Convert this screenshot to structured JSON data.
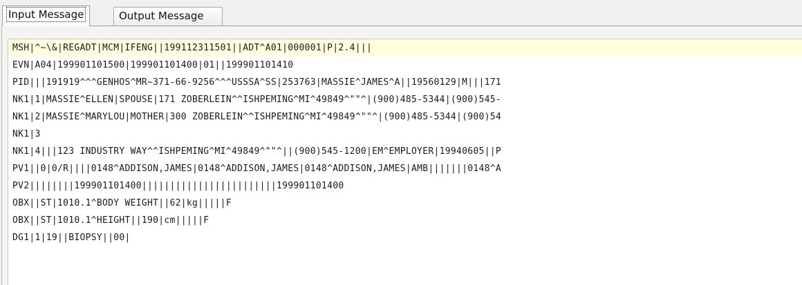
{
  "tabs": [
    {
      "label": "Input Message",
      "active": true
    },
    {
      "label": "Output Message",
      "active": false
    }
  ],
  "editor": {
    "highlight_color": "#ffffe0",
    "lines": [
      "MSH|^~\\&|REGADT|MCM|IFENG||199112311501||ADT^A01|000001|P|2.4|||",
      "EVN|A04|199901101500|199901101400|01||199901101410",
      "PID|||191919^^^GENHOS^MR~371-66-9256^^^USSSA^SS|253763|MASSIE^JAMES^A||19560129|M|||171",
      "NK1|1|MASSIE^ELLEN|SPOUSE|171 ZOBERLEIN^^ISHPEMING^MI^49849^\"\"^|(900)485-5344|(900)545-",
      "NK1|2|MASSIE^MARYLOU|MOTHER|300 ZOBERLEIN^^ISHPEMING^MI^49849^\"\"^|(900)485-5344|(900)54",
      "NK1|3",
      "NK1|4|||123 INDUSTRY WAY^^ISHPEMING^MI^49849^\"\"^||(900)545-1200|EM^EMPLOYER|19940605||P",
      "PV1||0|0/R||||0148^ADDISON,JAMES|0148^ADDISON,JAMES|0148^ADDISON,JAMES|AMB|||||||0148^A",
      "PV2||||||||199901101400||||||||||||||||||||||||199901101400",
      "OBX||ST|1010.1^BODY WEIGHT||62|kg|||||F",
      "OBX||ST|1010.1^HEIGHT||190|cm|||||F",
      "DG1|1|19||BIOPSY||00|"
    ]
  }
}
